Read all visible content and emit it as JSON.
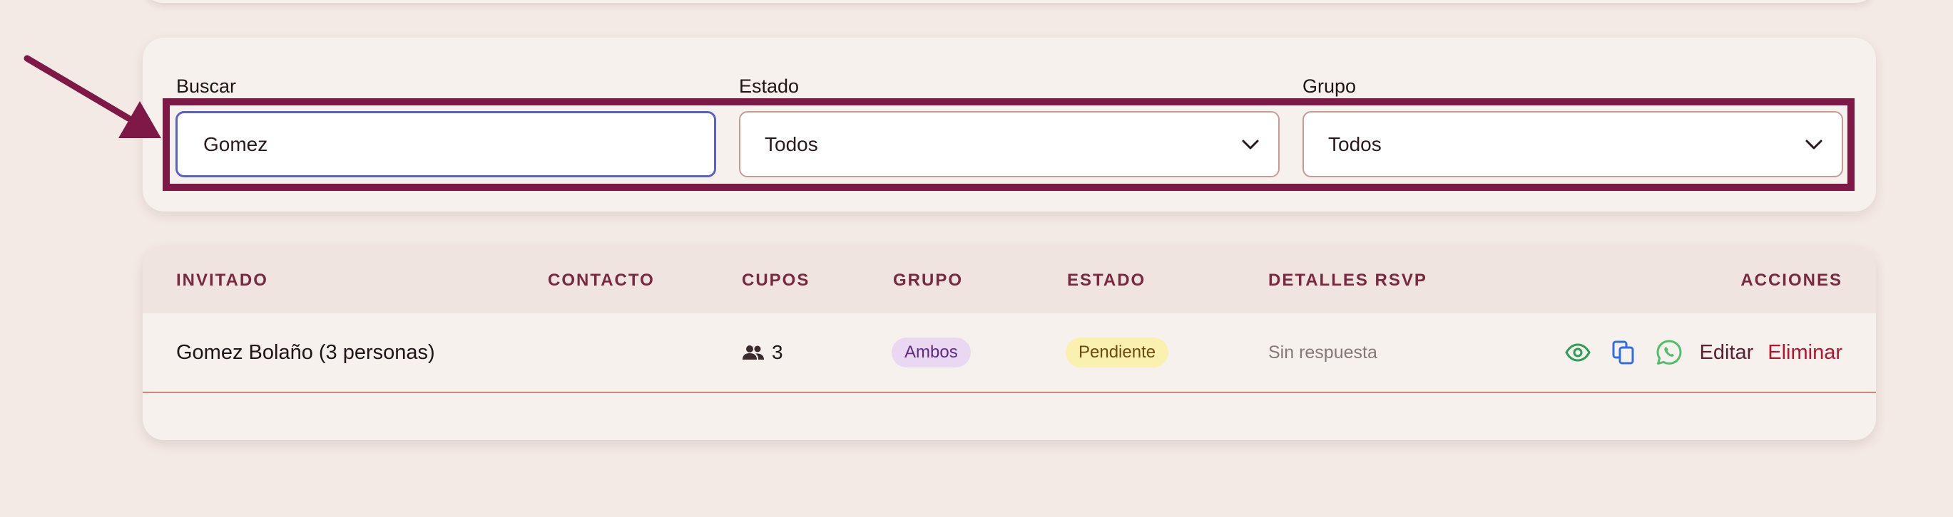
{
  "filters": {
    "search": {
      "label": "Buscar",
      "value": "Gomez"
    },
    "estado": {
      "label": "Estado",
      "selected": "Todos"
    },
    "grupo": {
      "label": "Grupo",
      "selected": "Todos"
    }
  },
  "table": {
    "headers": {
      "invitado": "INVITADO",
      "contacto": "CONTACTO",
      "cupos": "CUPOS",
      "grupo": "GRUPO",
      "estado": "ESTADO",
      "rsvp": "DETALLES RSVP",
      "acciones": "ACCIONES"
    },
    "rows": [
      {
        "invitado": "Gomez Bolaño (3 personas)",
        "contacto": "",
        "cupos": "3",
        "grupo": "Ambos",
        "estado": "Pendiente",
        "rsvp": "Sin respuesta",
        "actions": {
          "view_icon": "eye-icon",
          "copy_icon": "copy-icon",
          "whatsapp_icon": "whatsapp-icon",
          "edit_label": "Editar",
          "delete_label": "Eliminar"
        }
      }
    ]
  },
  "colors": {
    "background": "#f3e9e5",
    "card": "#f7f1ed",
    "header_text": "#7a2740",
    "highlight": "#7e1846",
    "input_focus": "#5c61c8",
    "badge_grupo_bg": "#ead8f3",
    "badge_estado_bg": "#faf0b0",
    "view_icon": "#2f9e55",
    "copy_icon": "#2f6fe0",
    "whatsapp_icon": "#4fbf6a",
    "delete": "#b4142e"
  }
}
